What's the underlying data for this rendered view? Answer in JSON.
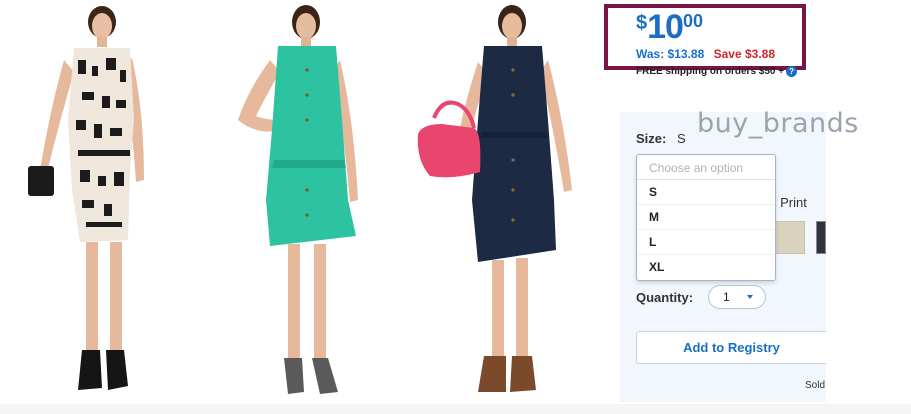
{
  "price": {
    "currency": "$",
    "dollars": "10",
    "cents": "00",
    "was": "Was: $13.88",
    "save": "Save $3.88"
  },
  "shipping": {
    "text": "FREE shipping on orders $50 +",
    "info_icon": "?"
  },
  "watermark": "buy_brands",
  "size": {
    "label": "Size:",
    "value": "S",
    "placeholder": "Choose an option",
    "options": [
      "S",
      "M",
      "L",
      "XL"
    ]
  },
  "color": {
    "label_partial": "k Print"
  },
  "quantity": {
    "label": "Quantity:",
    "value": "1"
  },
  "registry": {
    "button_label": "Add to Registry"
  },
  "seller": {
    "partial": "Sold"
  },
  "colors": {
    "price_blue": "#1a6fc4",
    "save_red": "#d0252c",
    "highlight_border": "#7a1348",
    "panel_bg": "#f2f7fd"
  },
  "images": [
    {
      "name": "black-white-print-dress"
    },
    {
      "name": "teal-dress"
    },
    {
      "name": "navy-dress-pink-bag"
    }
  ]
}
